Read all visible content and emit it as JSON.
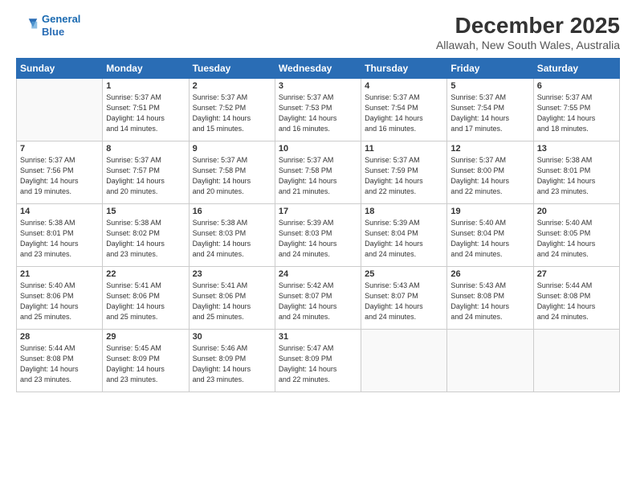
{
  "header": {
    "logo_line1": "General",
    "logo_line2": "Blue",
    "main_title": "December 2025",
    "subtitle": "Allawah, New South Wales, Australia"
  },
  "weekdays": [
    "Sunday",
    "Monday",
    "Tuesday",
    "Wednesday",
    "Thursday",
    "Friday",
    "Saturday"
  ],
  "weeks": [
    [
      {
        "day": "",
        "info": ""
      },
      {
        "day": "1",
        "info": "Sunrise: 5:37 AM\nSunset: 7:51 PM\nDaylight: 14 hours\nand 14 minutes."
      },
      {
        "day": "2",
        "info": "Sunrise: 5:37 AM\nSunset: 7:52 PM\nDaylight: 14 hours\nand 15 minutes."
      },
      {
        "day": "3",
        "info": "Sunrise: 5:37 AM\nSunset: 7:53 PM\nDaylight: 14 hours\nand 16 minutes."
      },
      {
        "day": "4",
        "info": "Sunrise: 5:37 AM\nSunset: 7:54 PM\nDaylight: 14 hours\nand 16 minutes."
      },
      {
        "day": "5",
        "info": "Sunrise: 5:37 AM\nSunset: 7:54 PM\nDaylight: 14 hours\nand 17 minutes."
      },
      {
        "day": "6",
        "info": "Sunrise: 5:37 AM\nSunset: 7:55 PM\nDaylight: 14 hours\nand 18 minutes."
      }
    ],
    [
      {
        "day": "7",
        "info": "Sunrise: 5:37 AM\nSunset: 7:56 PM\nDaylight: 14 hours\nand 19 minutes."
      },
      {
        "day": "8",
        "info": "Sunrise: 5:37 AM\nSunset: 7:57 PM\nDaylight: 14 hours\nand 20 minutes."
      },
      {
        "day": "9",
        "info": "Sunrise: 5:37 AM\nSunset: 7:58 PM\nDaylight: 14 hours\nand 20 minutes."
      },
      {
        "day": "10",
        "info": "Sunrise: 5:37 AM\nSunset: 7:58 PM\nDaylight: 14 hours\nand 21 minutes."
      },
      {
        "day": "11",
        "info": "Sunrise: 5:37 AM\nSunset: 7:59 PM\nDaylight: 14 hours\nand 22 minutes."
      },
      {
        "day": "12",
        "info": "Sunrise: 5:37 AM\nSunset: 8:00 PM\nDaylight: 14 hours\nand 22 minutes."
      },
      {
        "day": "13",
        "info": "Sunrise: 5:38 AM\nSunset: 8:01 PM\nDaylight: 14 hours\nand 23 minutes."
      }
    ],
    [
      {
        "day": "14",
        "info": "Sunrise: 5:38 AM\nSunset: 8:01 PM\nDaylight: 14 hours\nand 23 minutes."
      },
      {
        "day": "15",
        "info": "Sunrise: 5:38 AM\nSunset: 8:02 PM\nDaylight: 14 hours\nand 23 minutes."
      },
      {
        "day": "16",
        "info": "Sunrise: 5:38 AM\nSunset: 8:03 PM\nDaylight: 14 hours\nand 24 minutes."
      },
      {
        "day": "17",
        "info": "Sunrise: 5:39 AM\nSunset: 8:03 PM\nDaylight: 14 hours\nand 24 minutes."
      },
      {
        "day": "18",
        "info": "Sunrise: 5:39 AM\nSunset: 8:04 PM\nDaylight: 14 hours\nand 24 minutes."
      },
      {
        "day": "19",
        "info": "Sunrise: 5:40 AM\nSunset: 8:04 PM\nDaylight: 14 hours\nand 24 minutes."
      },
      {
        "day": "20",
        "info": "Sunrise: 5:40 AM\nSunset: 8:05 PM\nDaylight: 14 hours\nand 24 minutes."
      }
    ],
    [
      {
        "day": "21",
        "info": "Sunrise: 5:40 AM\nSunset: 8:06 PM\nDaylight: 14 hours\nand 25 minutes."
      },
      {
        "day": "22",
        "info": "Sunrise: 5:41 AM\nSunset: 8:06 PM\nDaylight: 14 hours\nand 25 minutes."
      },
      {
        "day": "23",
        "info": "Sunrise: 5:41 AM\nSunset: 8:06 PM\nDaylight: 14 hours\nand 25 minutes."
      },
      {
        "day": "24",
        "info": "Sunrise: 5:42 AM\nSunset: 8:07 PM\nDaylight: 14 hours\nand 24 minutes."
      },
      {
        "day": "25",
        "info": "Sunrise: 5:43 AM\nSunset: 8:07 PM\nDaylight: 14 hours\nand 24 minutes."
      },
      {
        "day": "26",
        "info": "Sunrise: 5:43 AM\nSunset: 8:08 PM\nDaylight: 14 hours\nand 24 minutes."
      },
      {
        "day": "27",
        "info": "Sunrise: 5:44 AM\nSunset: 8:08 PM\nDaylight: 14 hours\nand 24 minutes."
      }
    ],
    [
      {
        "day": "28",
        "info": "Sunrise: 5:44 AM\nSunset: 8:08 PM\nDaylight: 14 hours\nand 23 minutes."
      },
      {
        "day": "29",
        "info": "Sunrise: 5:45 AM\nSunset: 8:09 PM\nDaylight: 14 hours\nand 23 minutes."
      },
      {
        "day": "30",
        "info": "Sunrise: 5:46 AM\nSunset: 8:09 PM\nDaylight: 14 hours\nand 23 minutes."
      },
      {
        "day": "31",
        "info": "Sunrise: 5:47 AM\nSunset: 8:09 PM\nDaylight: 14 hours\nand 22 minutes."
      },
      {
        "day": "",
        "info": ""
      },
      {
        "day": "",
        "info": ""
      },
      {
        "day": "",
        "info": ""
      }
    ]
  ]
}
